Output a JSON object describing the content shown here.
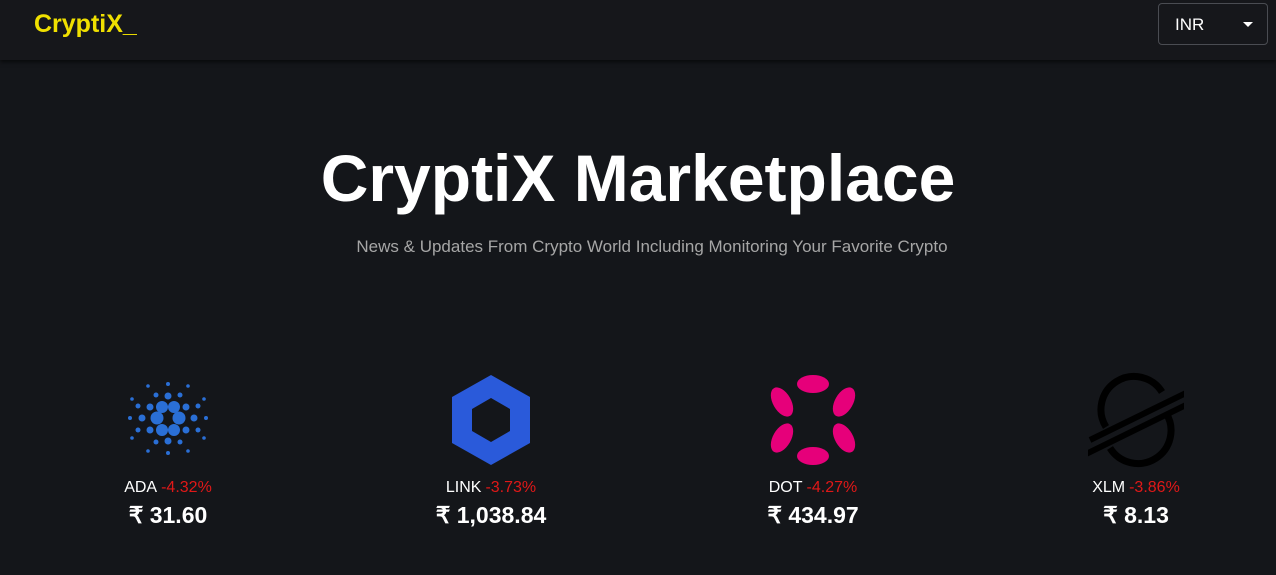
{
  "header": {
    "brand": "CryptiX_",
    "currency": "INR"
  },
  "hero": {
    "title": "CryptiX Marketplace",
    "subtitle": "News & Updates From Crypto World Including Monitoring Your Favorite Crypto"
  },
  "coins": [
    {
      "symbol": "ADA",
      "change": "-4.32%",
      "price": "₹ 31.60",
      "icon": "cardano-icon",
      "color": "#2a6fd6"
    },
    {
      "symbol": "LINK",
      "change": "-3.73%",
      "price": "₹ 1,038.84",
      "icon": "chainlink-icon",
      "color": "#2a5ada"
    },
    {
      "symbol": "DOT",
      "change": "-4.27%",
      "price": "₹ 434.97",
      "icon": "polkadot-icon",
      "color": "#e6007a"
    },
    {
      "symbol": "XLM",
      "change": "-3.86%",
      "price": "₹ 8.13",
      "icon": "stellar-icon",
      "color": "#000000"
    }
  ],
  "colors": {
    "background": "#14161a",
    "brand": "#f0e000",
    "negative": "#e01818"
  }
}
